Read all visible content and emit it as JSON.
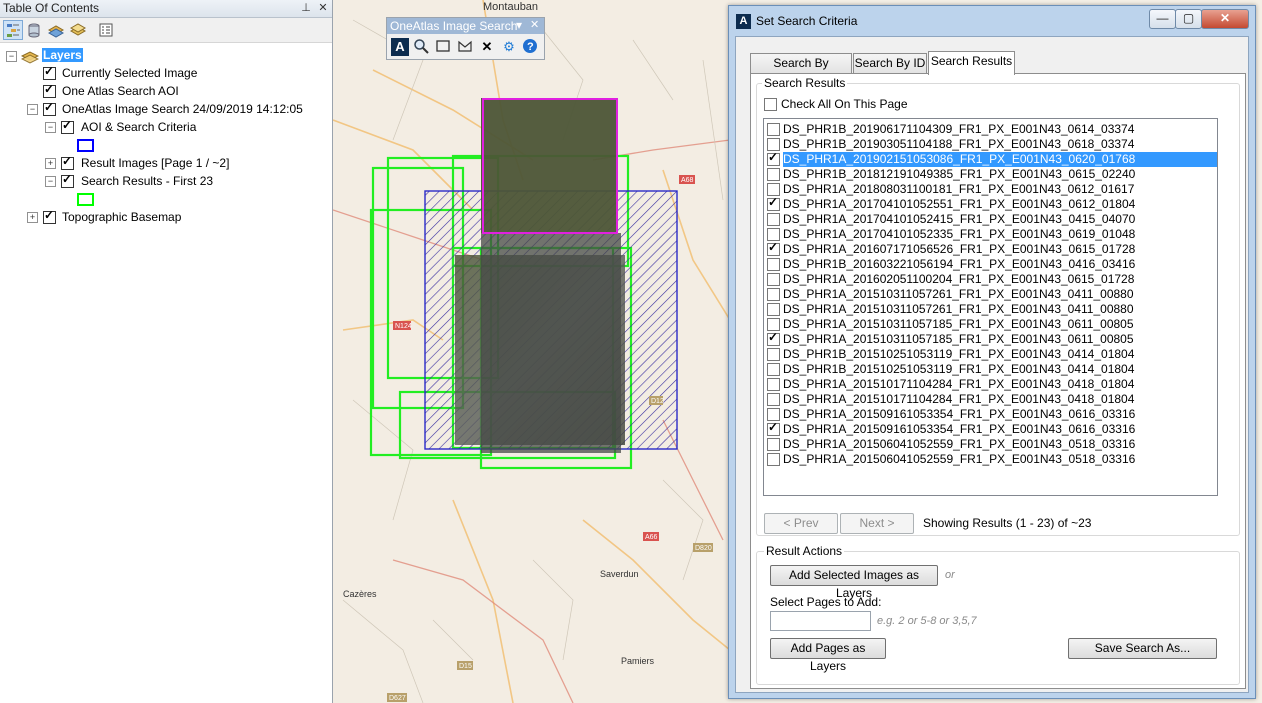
{
  "toc": {
    "title": "Table Of Contents",
    "pin_glyph": "📌",
    "close_glyph": "✕",
    "tree": {
      "root_label": "Layers",
      "items": [
        {
          "label": "Currently Selected Image"
        },
        {
          "label": "One Atlas Search AOI"
        },
        {
          "label": "OneAtlas Image Search 24/09/2019 14:12:05"
        },
        {
          "label": "AOI & Search Criteria"
        },
        {
          "label": "Result Images [Page 1 / ~2]"
        },
        {
          "label": "Search Results - First 23"
        },
        {
          "label": "Topographic Basemap"
        }
      ],
      "legend_colors": {
        "aoi": "#0000ff",
        "results": "#00ff00"
      }
    }
  },
  "map": {
    "labels": [
      "Montauban",
      "Saverdun",
      "Cazères",
      "Pamiers",
      "N124",
      "A68",
      "D15",
      "D627",
      "A66",
      "D820",
      "D12"
    ],
    "colors": {
      "aoi_hatch": "#3a2fa0",
      "results_outline": "#22ee22",
      "selected_outline": "#e020e0"
    }
  },
  "oa_toolbar": {
    "title": "OneAtlas Image Search",
    "dropdown_glyph": "▾",
    "close_glyph": "✕"
  },
  "dialog": {
    "title": "Set Search Criteria",
    "minimize_glyph": "—",
    "maximize_glyph": "▢",
    "close_glyph": "✕",
    "tabs": [
      "Search By Property",
      "Search By ID",
      "Search Results"
    ],
    "active_tab": "Search Results",
    "results_group_label": "Search Results",
    "check_all_label": "Check All On This Page",
    "results": [
      {
        "name": "DS_PHR1B_201906171104309_FR1_PX_E001N43_0614_03374",
        "checked": false,
        "selected": false
      },
      {
        "name": "DS_PHR1B_201903051104188_FR1_PX_E001N43_0618_03374",
        "checked": false,
        "selected": false
      },
      {
        "name": "DS_PHR1A_201902151053086_FR1_PX_E001N43_0620_01768",
        "checked": true,
        "selected": true
      },
      {
        "name": "DS_PHR1B_201812191049385_FR1_PX_E001N43_0615_02240",
        "checked": false,
        "selected": false
      },
      {
        "name": "DS_PHR1A_201808031100181_FR1_PX_E001N43_0612_01617",
        "checked": false,
        "selected": false
      },
      {
        "name": "DS_PHR1A_201704101052551_FR1_PX_E001N43_0612_01804",
        "checked": true,
        "selected": false
      },
      {
        "name": "DS_PHR1A_201704101052415_FR1_PX_E001N43_0415_04070",
        "checked": false,
        "selected": false
      },
      {
        "name": "DS_PHR1A_201704101052335_FR1_PX_E001N43_0619_01048",
        "checked": false,
        "selected": false
      },
      {
        "name": "DS_PHR1A_201607171056526_FR1_PX_E001N43_0615_01728",
        "checked": true,
        "selected": false
      },
      {
        "name": "DS_PHR1B_201603221056194_FR1_PX_E001N43_0416_03416",
        "checked": false,
        "selected": false
      },
      {
        "name": "DS_PHR1A_201602051100204_FR1_PX_E001N43_0615_01728",
        "checked": false,
        "selected": false
      },
      {
        "name": "DS_PHR1A_201510311057261_FR1_PX_E001N43_0411_00880",
        "checked": false,
        "selected": false
      },
      {
        "name": "DS_PHR1A_201510311057261_FR1_PX_E001N43_0411_00880",
        "checked": false,
        "selected": false
      },
      {
        "name": "DS_PHR1A_201510311057185_FR1_PX_E001N43_0611_00805",
        "checked": false,
        "selected": false
      },
      {
        "name": "DS_PHR1A_201510311057185_FR1_PX_E001N43_0611_00805",
        "checked": true,
        "selected": false
      },
      {
        "name": "DS_PHR1B_201510251053119_FR1_PX_E001N43_0414_01804",
        "checked": false,
        "selected": false
      },
      {
        "name": "DS_PHR1B_201510251053119_FR1_PX_E001N43_0414_01804",
        "checked": false,
        "selected": false
      },
      {
        "name": "DS_PHR1A_201510171104284_FR1_PX_E001N43_0418_01804",
        "checked": false,
        "selected": false
      },
      {
        "name": "DS_PHR1A_201510171104284_FR1_PX_E001N43_0418_01804",
        "checked": false,
        "selected": false
      },
      {
        "name": "DS_PHR1A_201509161053354_FR1_PX_E001N43_0616_03316",
        "checked": false,
        "selected": false
      },
      {
        "name": "DS_PHR1A_201509161053354_FR1_PX_E001N43_0616_03316",
        "checked": true,
        "selected": false
      },
      {
        "name": "DS_PHR1A_201506041052559_FR1_PX_E001N43_0518_03316",
        "checked": false,
        "selected": false
      },
      {
        "name": "DS_PHR1A_201506041052559_FR1_PX_E001N43_0518_03316",
        "checked": false,
        "selected": false
      }
    ],
    "prev_label": "< Prev",
    "next_label": "Next >",
    "showing_text": "Showing Results (1 - 23) of ~23",
    "actions_group_label": "Result Actions",
    "add_selected_label": "Add Selected Images as Layers",
    "or_text": "or",
    "pages_label": "Select Pages to Add:",
    "pages_value": "",
    "pages_hint": "e.g. 2 or 5-8 or 3,5,7",
    "add_pages_label": "Add Pages as Layers",
    "save_label": "Save Search As...",
    "accent": "#3399ff"
  }
}
